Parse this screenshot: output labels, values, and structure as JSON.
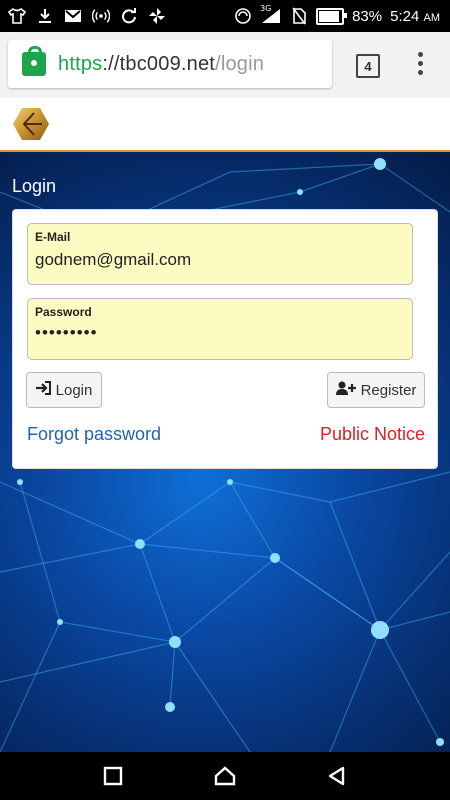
{
  "status_bar": {
    "battery_percent": "83%",
    "battery_level": 0.83,
    "time": "5:24",
    "ampm": "AM",
    "network": "3G",
    "icons": [
      "tshirt-icon",
      "download-icon",
      "gmail-icon",
      "hotspot-icon",
      "sync-icon",
      "pinwheel-icon"
    ]
  },
  "browser": {
    "url_scheme": "https",
    "url_sep": "://",
    "url_host": "tbc009.net",
    "url_path": "/login",
    "tab_count": "4"
  },
  "page": {
    "section_title": "Login",
    "email_label": "E-Mail",
    "email_value": "godnem@gmail.com",
    "password_label": "Password",
    "password_value": "•••••••••",
    "login_button": "Login",
    "register_button": "Register",
    "forgot_link": "Forgot password",
    "notice_link": "Public Notice"
  },
  "colors": {
    "accent_green": "#1ea44d",
    "link_blue": "#2067b0",
    "link_red": "#e02020",
    "field_bg": "#fbfbc2",
    "hero_blue": "#0a4aa6"
  }
}
